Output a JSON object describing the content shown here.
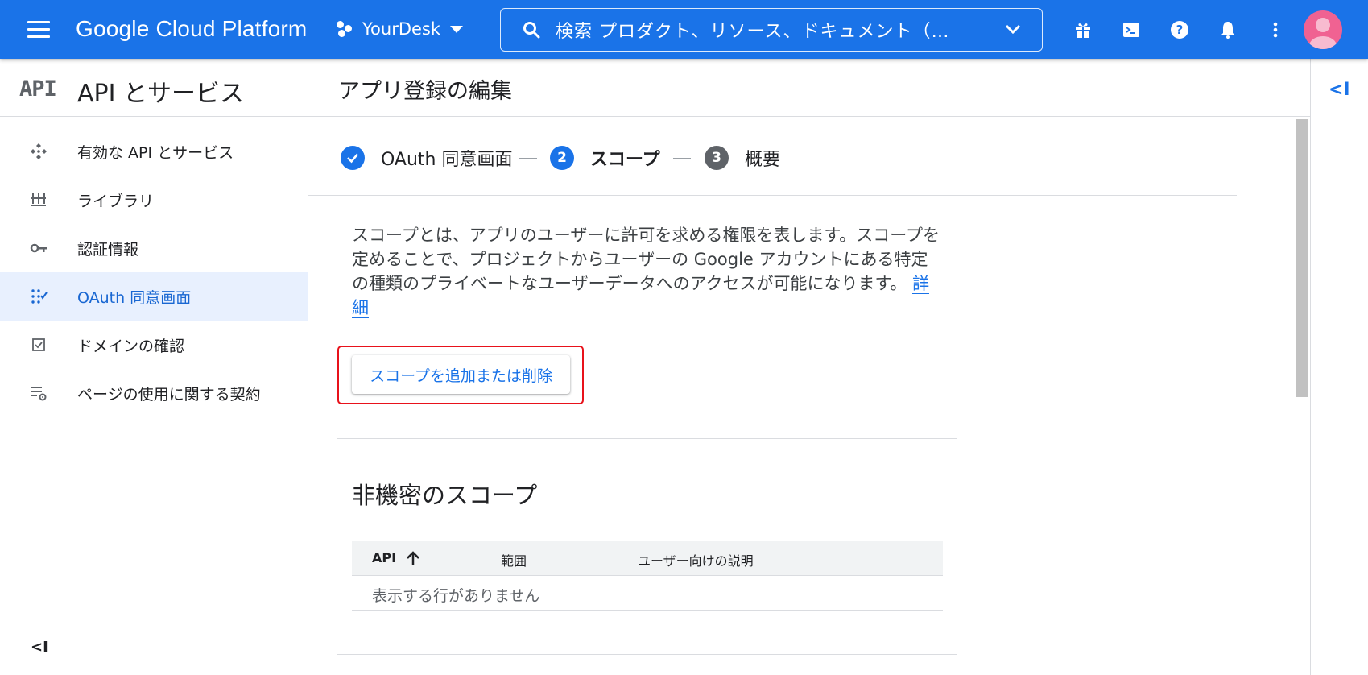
{
  "header": {
    "brand": "Google Cloud Platform",
    "project": "YourDesk",
    "search_placeholder": "検索  プロダクト、リソース、ドキュメント（…",
    "color": "#1a73e8",
    "icons": [
      "gift-icon",
      "cloud-shell-icon",
      "help-icon",
      "notifications-icon",
      "more-vert-icon",
      "avatar"
    ]
  },
  "sidebar": {
    "logo": "API",
    "title": "API とサービス",
    "items": [
      {
        "label": "有効な API とサービス",
        "icon": "api-dashboard-icon",
        "active": false
      },
      {
        "label": "ライブラリ",
        "icon": "library-icon",
        "active": false
      },
      {
        "label": "認証情報",
        "icon": "key-icon",
        "active": false
      },
      {
        "label": "OAuth 同意画面",
        "icon": "consent-icon",
        "active": true
      },
      {
        "label": "ドメインの確認",
        "icon": "checkbox-icon",
        "active": false
      },
      {
        "label": "ページの使用に関する契約",
        "icon": "settings-list-icon",
        "active": false
      }
    ],
    "collapse_label": "<I"
  },
  "main": {
    "title": "アプリ登録の編集",
    "steps": [
      {
        "label": "OAuth 同意画面",
        "state": "done"
      },
      {
        "number": "2",
        "label": "スコープ",
        "state": "current"
      },
      {
        "number": "3",
        "label": "概要",
        "state": "upcoming"
      }
    ],
    "description": "スコープとは、アプリのユーザーに許可を求める権限を表します。スコープを定めることで、プロジェクトからユーザーの Google アカウントにある特定の種類のプライベートなユーザーデータへのアクセスが可能になります。",
    "description_link": "詳細",
    "add_scope_button": "スコープを追加または削除",
    "section_title": "非機密のスコープ",
    "table": {
      "columns": [
        "API",
        "範囲",
        "ユーザー向けの説明"
      ],
      "sort_column": "API",
      "empty_text": "表示する行がありません"
    }
  },
  "right_rail": {
    "expand_label": "<I"
  }
}
